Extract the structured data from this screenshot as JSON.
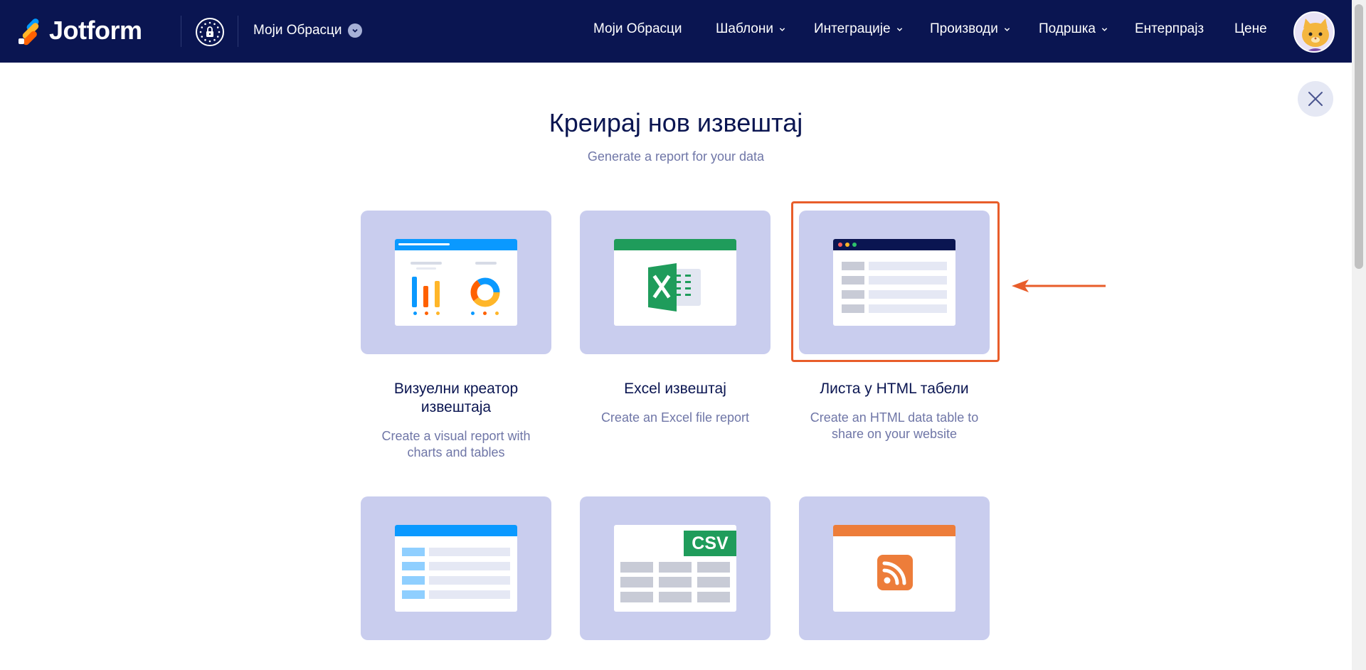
{
  "brand": {
    "name": "Jotform"
  },
  "workspace": {
    "label": "Моји Обрасци"
  },
  "nav": [
    {
      "label": "Моји Обрасци",
      "dropdown": false
    },
    {
      "label": "Шаблони",
      "dropdown": true
    },
    {
      "label": "Интеграције",
      "dropdown": true
    },
    {
      "label": "Производи",
      "dropdown": true
    },
    {
      "label": "Подршка",
      "dropdown": true
    },
    {
      "label": "Ентерпрајз",
      "dropdown": false
    },
    {
      "label": "Цене",
      "dropdown": false
    }
  ],
  "page": {
    "title": "Креирај нов извештај",
    "subtitle": "Generate a report for your data"
  },
  "cards": [
    {
      "name": "Визуелни креатор извештаја",
      "desc": "Create a visual report with charts and tables",
      "icon": "visual-report-icon"
    },
    {
      "name": "Excel извештај",
      "desc": "Create an Excel file report",
      "icon": "excel-icon"
    },
    {
      "name": "Листа у HTML табели",
      "desc": "Create an HTML data table to share on your website",
      "icon": "html-table-icon",
      "selected": true
    },
    {
      "name": "",
      "desc": "",
      "icon": "table-list-icon"
    },
    {
      "name": "",
      "desc": "",
      "icon": "csv-icon",
      "badge": "CSV"
    },
    {
      "name": "",
      "desc": "",
      "icon": "rss-icon"
    }
  ],
  "colors": {
    "nav_bg": "#0a1551",
    "card_bg": "#c9cdee",
    "highlight": "#e85d2a",
    "excel_green": "#1f9c5b",
    "rss_orange": "#ed7d3a",
    "blue": "#0a99ff"
  }
}
